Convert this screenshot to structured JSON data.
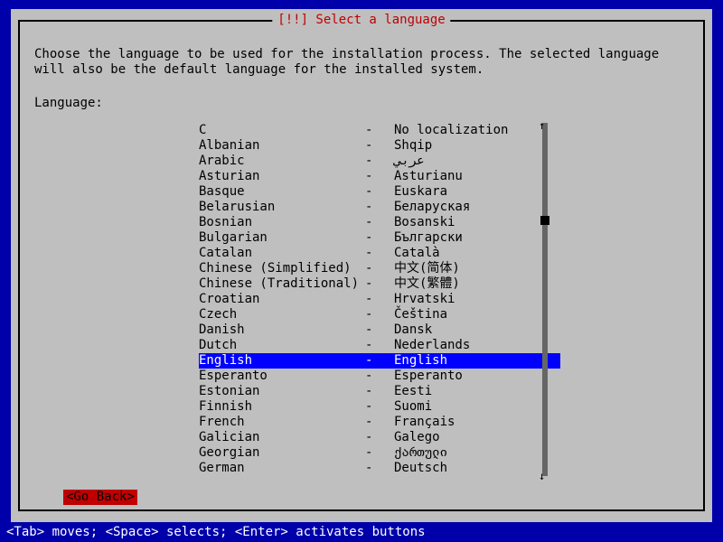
{
  "dialog": {
    "title": "[!!] Select a language",
    "instruction": "Choose the language to be used for the installation process. The selected language will also be the default language for the installed system.",
    "language_label": "Language:",
    "go_back": "<Go Back>"
  },
  "languages": [
    {
      "en": "C",
      "native": "No localization",
      "selected": false
    },
    {
      "en": "Albanian",
      "native": "Shqip",
      "selected": false
    },
    {
      "en": "Arabic",
      "native": "عربي",
      "selected": false
    },
    {
      "en": "Asturian",
      "native": "Asturianu",
      "selected": false
    },
    {
      "en": "Basque",
      "native": "Euskara",
      "selected": false
    },
    {
      "en": "Belarusian",
      "native": "Беларуская",
      "selected": false
    },
    {
      "en": "Bosnian",
      "native": "Bosanski",
      "selected": false
    },
    {
      "en": "Bulgarian",
      "native": "Български",
      "selected": false
    },
    {
      "en": "Catalan",
      "native": "Català",
      "selected": false
    },
    {
      "en": "Chinese (Simplified)",
      "native": "中文(简体)",
      "selected": false
    },
    {
      "en": "Chinese (Traditional)",
      "native": "中文(繁體)",
      "selected": false
    },
    {
      "en": "Croatian",
      "native": "Hrvatski",
      "selected": false
    },
    {
      "en": "Czech",
      "native": "Čeština",
      "selected": false
    },
    {
      "en": "Danish",
      "native": "Dansk",
      "selected": false
    },
    {
      "en": "Dutch",
      "native": "Nederlands",
      "selected": false
    },
    {
      "en": "English",
      "native": "English",
      "selected": true
    },
    {
      "en": "Esperanto",
      "native": "Esperanto",
      "selected": false
    },
    {
      "en": "Estonian",
      "native": "Eesti",
      "selected": false
    },
    {
      "en": "Finnish",
      "native": "Suomi",
      "selected": false
    },
    {
      "en": "French",
      "native": "Français",
      "selected": false
    },
    {
      "en": "Galician",
      "native": "Galego",
      "selected": false
    },
    {
      "en": "Georgian",
      "native": "ქართული",
      "selected": false
    },
    {
      "en": "German",
      "native": "Deutsch",
      "selected": false
    }
  ],
  "separator": "-",
  "footer": "<Tab> moves; <Space> selects; <Enter> activates buttons"
}
